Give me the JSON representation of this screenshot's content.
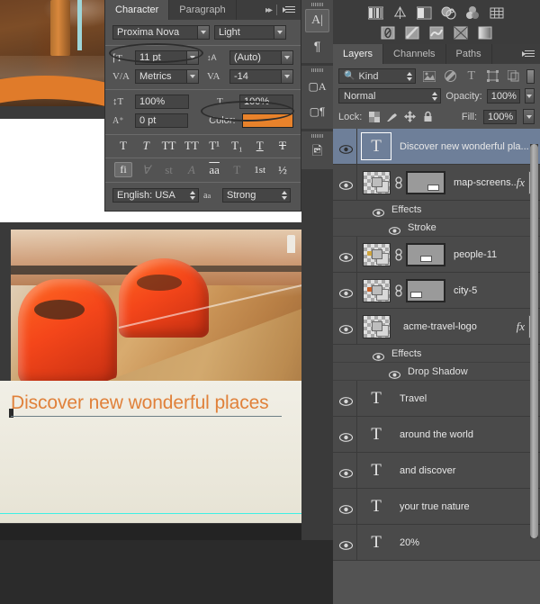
{
  "app": "Adobe Photoshop",
  "character_panel": {
    "tabs": [
      {
        "label": "Character",
        "active": true
      },
      {
        "label": "Paragraph",
        "active": false
      }
    ],
    "collapse_icon": "double-arrow-right-icon",
    "menu_icon": "panel-menu-icon",
    "font_family": "Proxima Nova",
    "font_style": "Light",
    "font_size_icon": "font-size-icon",
    "font_size": "11 pt",
    "leading_icon": "leading-icon",
    "leading": "(Auto)",
    "kerning_icon": "kerning-icon",
    "kerning": "Metrics",
    "tracking_icon": "tracking-icon",
    "tracking": "-14",
    "vertical_scale_icon": "vertical-scale-icon",
    "vertical_scale": "100%",
    "horizontal_scale_icon": "horizontal-scale-icon",
    "horizontal_scale": "100%",
    "baseline_icon": "baseline-shift-icon",
    "baseline_shift": "0 pt",
    "color_label": "Color:",
    "color_value": "#e8822b",
    "style_buttons": [
      {
        "name": "faux-bold",
        "glyph": "T",
        "dim": false
      },
      {
        "name": "faux-italic",
        "glyph": "T",
        "dim": false
      },
      {
        "name": "all-caps",
        "glyph": "TT",
        "dim": false
      },
      {
        "name": "small-caps",
        "glyph": "TT",
        "dim": false
      },
      {
        "name": "superscript",
        "glyph": "T¹",
        "dim": false
      },
      {
        "name": "subscript",
        "glyph": "T₁",
        "dim": false
      },
      {
        "name": "underline",
        "glyph": "T",
        "dim": false
      },
      {
        "name": "strikethrough",
        "glyph": "T",
        "dim": false
      }
    ],
    "opentype_buttons": [
      {
        "name": "standard-ligatures",
        "glyph": "fi",
        "dim": false,
        "boxed": true
      },
      {
        "name": "contextual-alternates",
        "glyph": "Ɐ",
        "dim": true,
        "boxed": false
      },
      {
        "name": "discretionary-ligatures",
        "glyph": "st",
        "dim": true,
        "boxed": false
      },
      {
        "name": "swash",
        "glyph": "A",
        "dim": true,
        "boxed": false
      },
      {
        "name": "oldstyle",
        "glyph": "aa",
        "dim": false,
        "boxed": false
      },
      {
        "name": "titling-alternates",
        "glyph": "T",
        "dim": true,
        "boxed": false
      },
      {
        "name": "ordinals",
        "glyph": "1st",
        "dim": false,
        "boxed": false
      },
      {
        "name": "fractions",
        "glyph": "½",
        "dim": false,
        "boxed": false
      }
    ],
    "language": "English: USA",
    "antialias_icon": "anti-alias-icon",
    "antialias": "Strong"
  },
  "tool_strip": {
    "groups": [
      {
        "buttons": [
          {
            "name": "text-tool",
            "glyph": "A",
            "active": true
          },
          {
            "name": "paragraph-tool",
            "glyph": "¶",
            "active": false
          }
        ]
      },
      {
        "buttons": [
          {
            "name": "character-styles",
            "glyph": "A",
            "active": false
          },
          {
            "name": "paragraph-styles",
            "glyph": "¶",
            "active": false
          }
        ]
      },
      {
        "buttons": [
          {
            "name": "libraries",
            "glyph": "▣",
            "active": false
          }
        ]
      }
    ]
  },
  "layers_panel": {
    "adjustment_icons_row1": [
      "brightness-contrast-icon",
      "levels-icon",
      "curves-icon",
      "exposure-icon",
      "vibrance-icon",
      "hue-saturation-icon"
    ],
    "adjustment_icons_row2": [
      "color-balance-icon",
      "black-white-icon",
      "photo-filter-icon",
      "channel-mixer-icon",
      "gradient-map-icon"
    ],
    "tabs": [
      {
        "label": "Layers",
        "active": true
      },
      {
        "label": "Channels",
        "active": false
      },
      {
        "label": "Paths",
        "active": false
      }
    ],
    "menu_icon": "panel-menu-icon",
    "filter": {
      "search_icon": "search-icon",
      "kind_label": "Kind",
      "type_icons": [
        "pixel-filter-icon",
        "adjustment-filter-icon",
        "type-filter-icon",
        "shape-filter-icon",
        "smart-object-filter-icon"
      ],
      "toggle_icon": "filter-toggle-icon"
    },
    "blend_mode": "Normal",
    "opacity_label": "Opacity:",
    "opacity_value": "100%",
    "lock_label": "Lock:",
    "lock_icons": [
      "lock-transparent-pixels-icon",
      "lock-image-pixels-icon",
      "lock-position-icon",
      "lock-all-icon"
    ],
    "fill_label": "Fill:",
    "fill_value": "100%",
    "layers": [
      {
        "name": "Discover new wonderful pla...",
        "type": "text",
        "visible": true,
        "selected": true,
        "has_fx": false,
        "has_mask": false,
        "effects": []
      },
      {
        "name": "map-screens...",
        "type": "image",
        "visible": true,
        "selected": false,
        "has_fx": true,
        "has_mask": true,
        "mask_slot": "right",
        "effects": [
          "Effects",
          "Stroke"
        ]
      },
      {
        "name": "people-11",
        "type": "image",
        "visible": true,
        "selected": false,
        "has_fx": false,
        "has_mask": true,
        "mask_slot": "center",
        "effects": []
      },
      {
        "name": "city-5",
        "type": "image",
        "visible": true,
        "selected": false,
        "has_fx": false,
        "has_mask": true,
        "mask_slot": "left",
        "effects": []
      },
      {
        "name": "acme-travel-logo",
        "type": "image",
        "visible": true,
        "selected": false,
        "has_fx": true,
        "has_mask": false,
        "effects": [
          "Effects",
          "Drop Shadow"
        ]
      },
      {
        "name": "Travel",
        "type": "text",
        "visible": true,
        "selected": false,
        "has_fx": false,
        "has_mask": false,
        "effects": []
      },
      {
        "name": "around the world",
        "type": "text",
        "visible": true,
        "selected": false,
        "has_fx": false,
        "has_mask": false,
        "effects": []
      },
      {
        "name": "and discover",
        "type": "text",
        "visible": true,
        "selected": false,
        "has_fx": false,
        "has_mask": false,
        "effects": []
      },
      {
        "name": "your true nature",
        "type": "text",
        "visible": true,
        "selected": false,
        "has_fx": false,
        "has_mask": false,
        "effects": []
      },
      {
        "name": "20%",
        "type": "text",
        "visible": true,
        "selected": false,
        "has_fx": false,
        "has_mask": false,
        "effects": []
      }
    ],
    "scrollbar": "layers-vertical-scrollbar"
  },
  "canvas": {
    "headline": "Discover new wonderful places",
    "headline_color": "#e0813a",
    "swoosh_color": "#e07b2a",
    "guide_color": "#3ef0e4",
    "background_color": "#eae7da"
  }
}
